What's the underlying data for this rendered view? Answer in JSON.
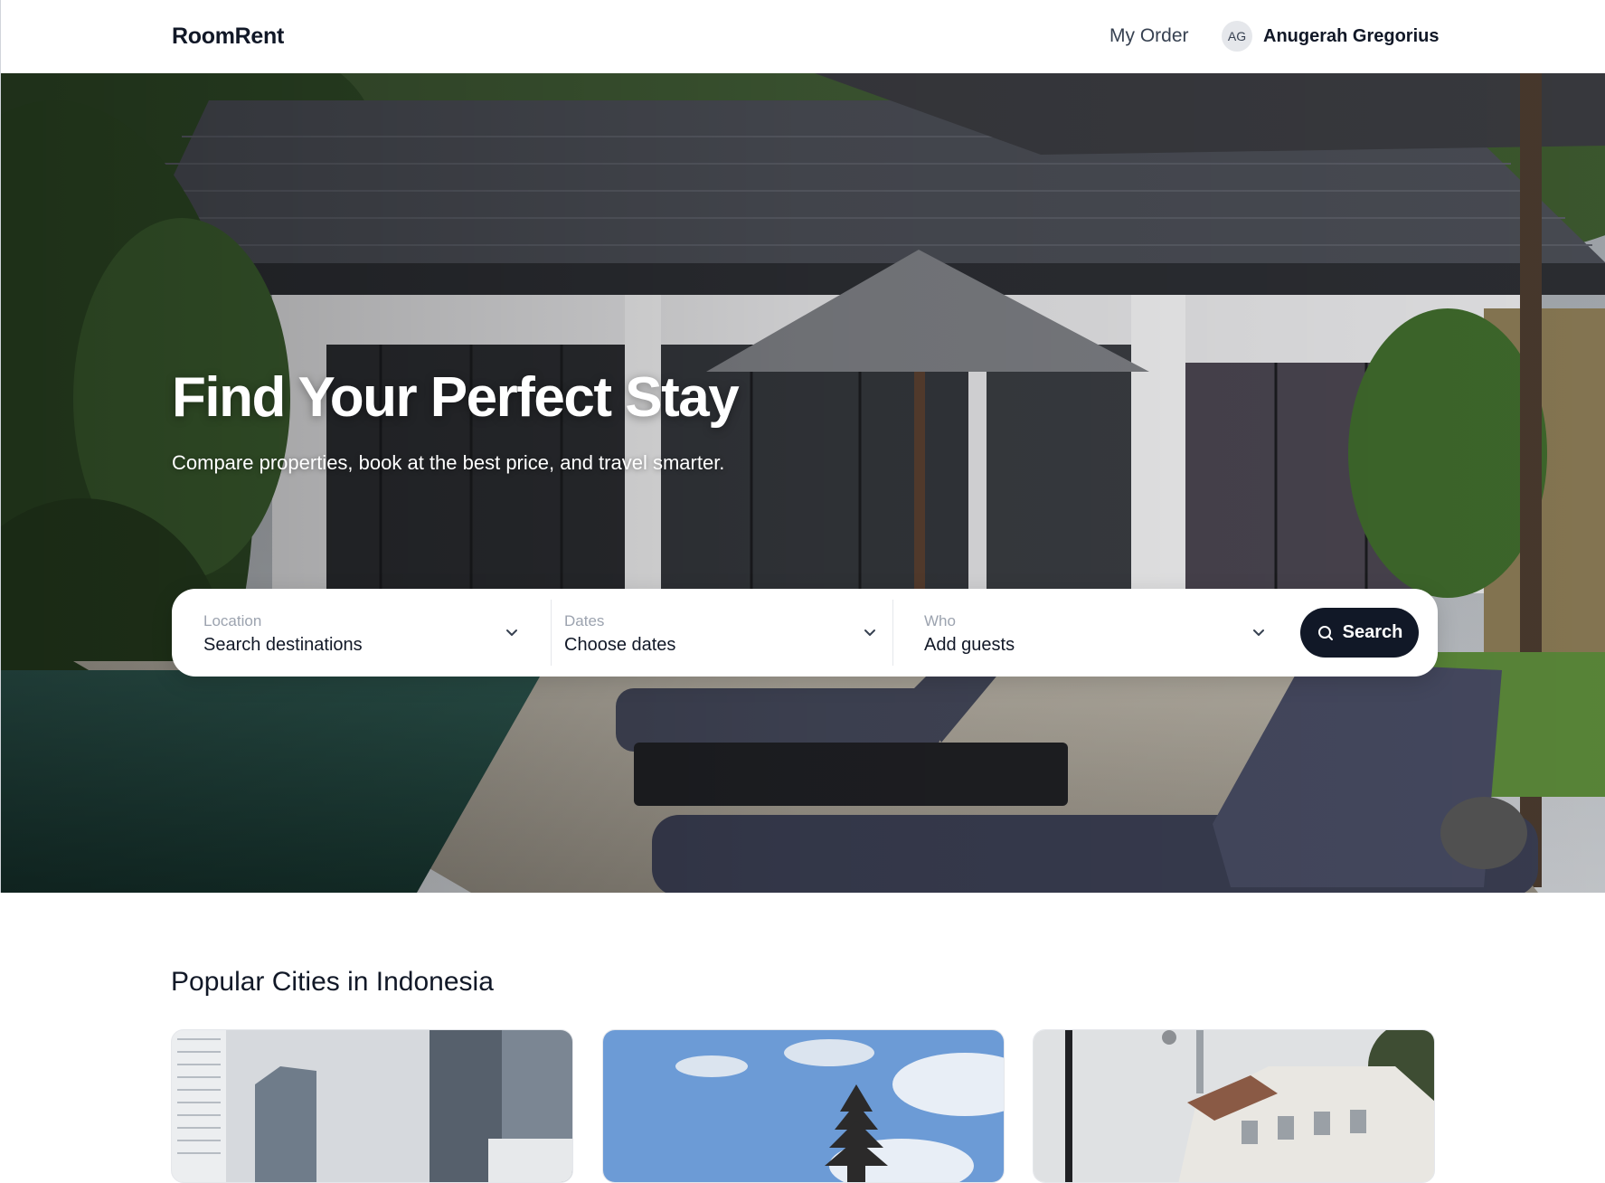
{
  "header": {
    "brand": "RoomRent",
    "my_order": "My Order",
    "user": {
      "initials": "AG",
      "name": "Anugerah Gregorius"
    }
  },
  "hero": {
    "title": "Find Your Perfect Stay",
    "subtitle": "Compare properties, book at the best price, and travel smarter."
  },
  "search": {
    "location": {
      "label": "Location",
      "value": "Search destinations"
    },
    "dates": {
      "label": "Dates",
      "value": "Choose dates"
    },
    "who": {
      "label": "Who",
      "value": "Add guests"
    },
    "button": "Search"
  },
  "popular": {
    "title": "Popular Cities in Indonesia"
  },
  "colors": {
    "primary": "#111827",
    "muted": "#9ca3af"
  }
}
